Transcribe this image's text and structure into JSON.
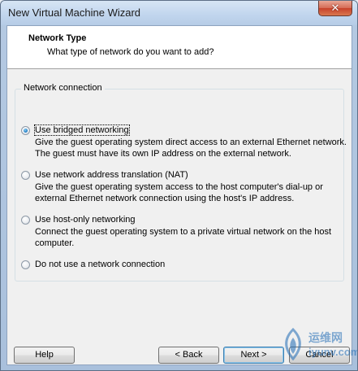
{
  "window": {
    "title": "New Virtual Machine Wizard",
    "close_glyph": "✕"
  },
  "header": {
    "title": "Network Type",
    "subtitle": "What type of network do you want to add?"
  },
  "group": {
    "label": "Network connection",
    "options": [
      {
        "label": "Use bridged networking",
        "description": "Give the guest operating system direct access to an external Ethernet network. The guest must have its own IP address on the external network.",
        "checked": true
      },
      {
        "label": "Use network address translation (NAT)",
        "description": "Give the guest operating system access to the host computer's dial-up or external Ethernet network connection using the host's IP address.",
        "checked": false
      },
      {
        "label": "Use host-only networking",
        "description": "Connect the guest operating system to a private virtual network on the host computer.",
        "checked": false
      },
      {
        "label": "Do not use a network connection",
        "description": "",
        "checked": false
      }
    ]
  },
  "buttons": {
    "help": "Help",
    "back": "< Back",
    "next": "Next >",
    "cancel": "Cancel"
  },
  "watermark": {
    "cn": "运维网",
    "en": "iyunv.com"
  },
  "colors": {
    "accent": "#2a84c8",
    "titlebar": "#c2d6ee"
  }
}
